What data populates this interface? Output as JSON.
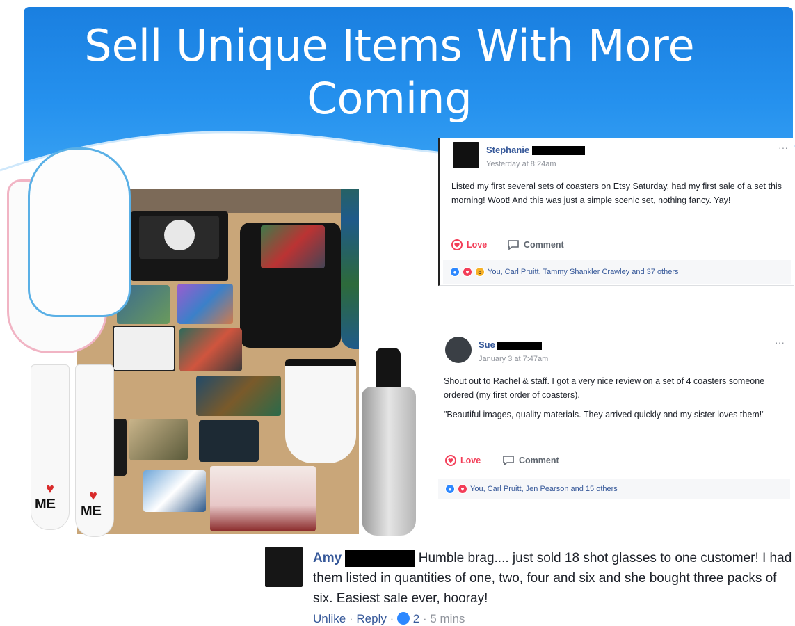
{
  "slide": {
    "title_line1": "Sell Unique Items With More",
    "title_line2": "Coming",
    "colors": {
      "header": "#2591ee",
      "accent_fb": "#365899",
      "love": "#f33e58"
    }
  },
  "posts": [
    {
      "name": "Stephanie",
      "time": "Yesterday at 8:24am",
      "text": "Listed my first several sets of coasters on Etsy Saturday, had my first sale of a set this morning! Woot! And this was just a simple scenic set, nothing fancy. Yay!",
      "love_label": "Love",
      "comment_label": "Comment",
      "reactions": "You, Carl Pruitt, Tammy Shankler Crawley and 37 others",
      "more": "···"
    },
    {
      "name": "Sue",
      "time": "January 3 at 7:47am",
      "text1": "Shout out to Rachel & staff. I got a very nice review on a set of 4 coasters someone ordered (my first order of coasters).",
      "text2": "\"Beautiful images, quality materials. They arrived quickly and my sister loves them!\"",
      "love_label": "Love",
      "comment_label": "Comment",
      "reactions": "You, Carl Pruitt, Jen Pearson and 15 others",
      "more": "···"
    }
  ],
  "comment": {
    "name": "Amy",
    "text": "Humble brag.... just sold 18 shot glasses to one customer! I had them listed in quantities of one, two, four and six and she bought three packs of six. Easiest sale ever, hooray!",
    "unlike": "Unlike",
    "reply": "Reply",
    "likes": "2",
    "time": "5 mins",
    "sep": "·"
  },
  "products_photo": {
    "sock_lettering": [
      "ME",
      "ME"
    ]
  }
}
